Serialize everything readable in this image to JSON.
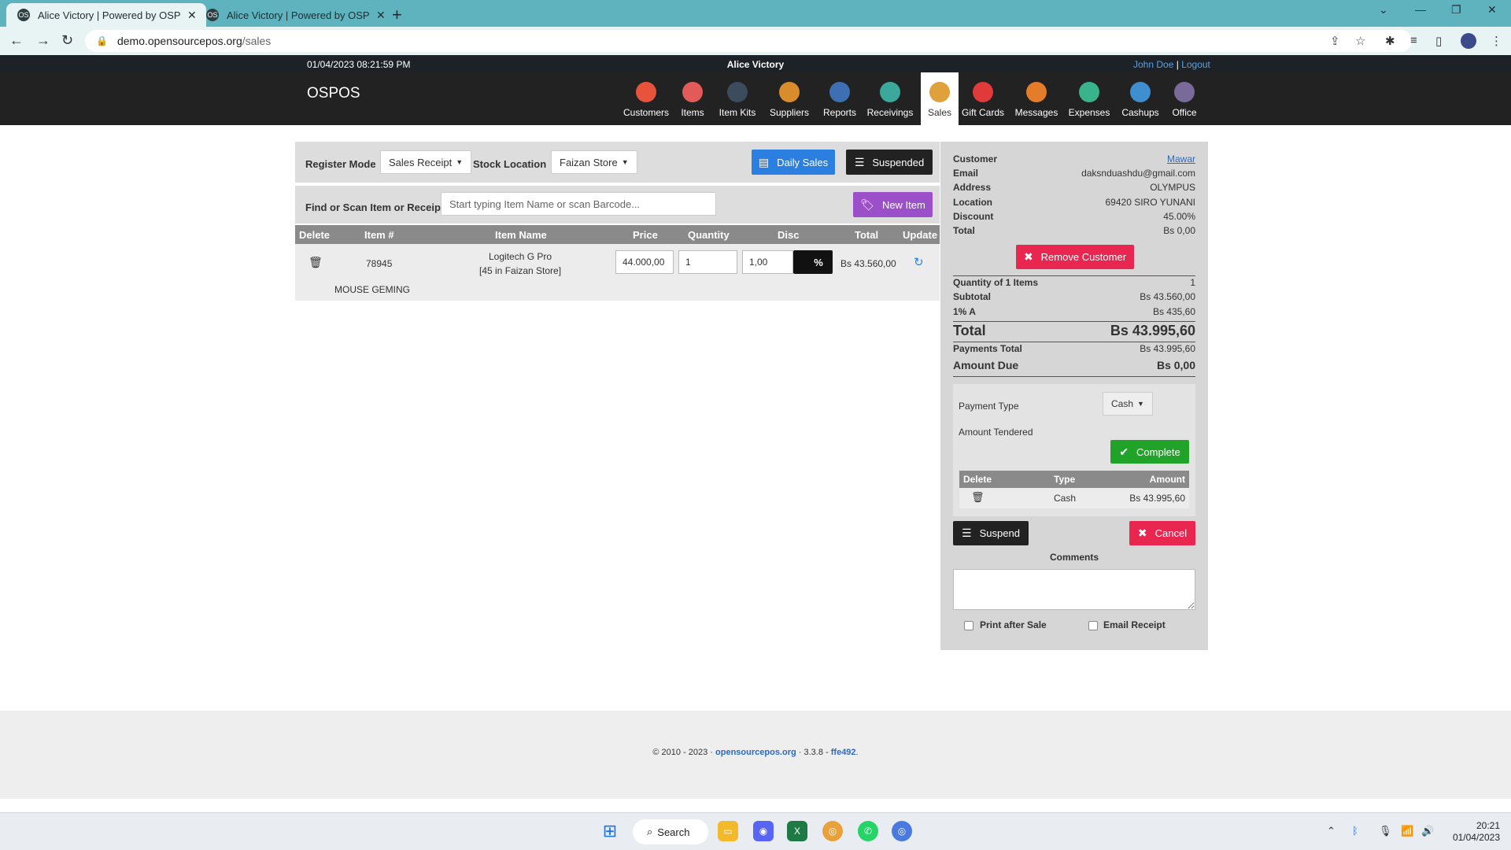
{
  "browser": {
    "tabs": [
      {
        "title": "Alice Victory | Powered by OSPOS",
        "active": true
      },
      {
        "title": "Alice Victory | Powered by OSPOS",
        "active": false
      }
    ],
    "url_host": "demo.opensourcepos.org",
    "url_path": "/sales"
  },
  "topbar": {
    "datetime": "01/04/2023 08:21:59 PM",
    "company": "Alice Victory",
    "user": "John Doe",
    "separator": "|",
    "logout": "Logout"
  },
  "nav": {
    "brand": "OSPOS",
    "modules": [
      {
        "label": "Customers",
        "color": "#e8533b"
      },
      {
        "label": "Items",
        "color": "#e25a5a"
      },
      {
        "label": "Item Kits",
        "color": "#3c4b5e"
      },
      {
        "label": "Suppliers",
        "color": "#d98c2b"
      },
      {
        "label": "Reports",
        "color": "#3e6fb3"
      },
      {
        "label": "Receivings",
        "color": "#3aa89a"
      },
      {
        "label": "Sales",
        "color": "#e0a13a"
      },
      {
        "label": "Gift Cards",
        "color": "#e03a3a"
      },
      {
        "label": "Messages",
        "color": "#e57c2a"
      },
      {
        "label": "Expenses",
        "color": "#39b38c"
      },
      {
        "label": "Cashups",
        "color": "#3f8fd0"
      },
      {
        "label": "Office",
        "color": "#7a6a9a"
      }
    ]
  },
  "register": {
    "mode_label": "Register Mode",
    "mode_value": "Sales Receipt",
    "location_label": "Stock Location",
    "location_value": "Faizan Store",
    "daily_sales": "Daily Sales",
    "suspended": "Suspended",
    "find_label": "Find or Scan Item or Receipt",
    "find_placeholder": "Start typing Item Name or scan Barcode...",
    "new_item": "New Item"
  },
  "cart": {
    "headers": [
      "Delete",
      "Item #",
      "Item Name",
      "Price",
      "Quantity",
      "Disc",
      "Total",
      "Update"
    ],
    "item": {
      "number": "78945",
      "name": "Logitech G Pro",
      "stock": "[45 in Faizan Store]",
      "price": "44.000,00",
      "quantity": "1",
      "discount": "1,00",
      "discount_type": "%",
      "total": "Bs 43.560,00",
      "description": "MOUSE GEMING"
    }
  },
  "customer": {
    "rows": [
      {
        "k": "Customer",
        "v": "Mawar"
      },
      {
        "k": "Email",
        "v": "daksnduashdu@gmail.com"
      },
      {
        "k": "Address",
        "v": "OLYMPUS"
      },
      {
        "k": "Location",
        "v": "69420 SIRO YUNANI"
      },
      {
        "k": "Discount",
        "v": "45.00%"
      },
      {
        "k": "Total",
        "v": "Bs 0,00"
      }
    ],
    "remove_button": "Remove Customer"
  },
  "summary": {
    "qty_label": "Quantity of 1 Items",
    "qty_value": "1",
    "subtotal_label": "Subtotal",
    "subtotal_value": "Bs 43.560,00",
    "tax_label": "1% A",
    "tax_value": "Bs 435,60",
    "total_label": "Total",
    "total_value": "Bs 43.995,60",
    "payments_label": "Payments Total",
    "payments_value": "Bs 43.995,60",
    "due_label": "Amount Due",
    "due_value": "Bs 0,00"
  },
  "payment": {
    "type_label": "Payment Type",
    "type_value": "Cash",
    "tendered_label": "Amount Tendered",
    "complete": "Complete",
    "headers": [
      "Delete",
      "Type",
      "Amount"
    ],
    "row": {
      "type": "Cash",
      "amount": "Bs 43.995,60"
    }
  },
  "actions": {
    "suspend": "Suspend",
    "cancel": "Cancel",
    "comments_label": "Comments",
    "print_after_sale": "Print after Sale",
    "email_receipt": "Email Receipt"
  },
  "footer": {
    "copyright": "© 2010 - 2023 · ",
    "site": "opensourcepos.org",
    "version": " · 3.3.8 - ",
    "commit": "ffe492",
    "end": "."
  },
  "taskbar": {
    "search": "Search",
    "time": "20:21",
    "date": "01/04/2023"
  },
  "colors": {
    "primary": "#2a7fe0",
    "purple": "#9b4fc9",
    "danger": "#e8264f",
    "success": "#21a329",
    "dark": "#222222"
  }
}
